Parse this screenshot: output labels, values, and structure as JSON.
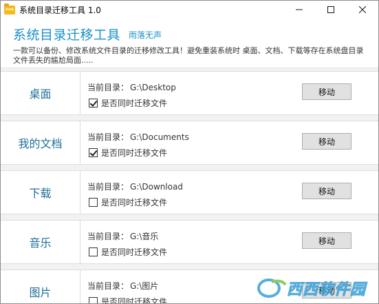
{
  "window": {
    "title": "系统目录迁移工具 1.0",
    "controls": {
      "minimize": "minimize",
      "maximize": "maximize",
      "close": "close"
    }
  },
  "header": {
    "title": "系统目录迁移工具",
    "author": "雨落无声",
    "description": "一款可以备份、修改系统文件目录的迁移修改工具！避免重装系统时 桌面、文档、下载等存在系统盘目录文件丢失的尴尬局面....."
  },
  "current_dir_prefix": "当前目录：",
  "checkbox_label": "是否同时迁移文件",
  "move_label": "移动",
  "rows": [
    {
      "label": "桌面",
      "path": "G:\\Desktop",
      "checked": true
    },
    {
      "label": "我的文档",
      "path": "G:\\Documents",
      "checked": true
    },
    {
      "label": "下载",
      "path": "G:\\Download",
      "checked": false
    },
    {
      "label": "音乐",
      "path": "G:\\音乐",
      "checked": false
    },
    {
      "label": "图片",
      "path": "G:\\图片",
      "checked": false
    }
  ],
  "watermark": {
    "text": "西西软件园"
  },
  "colors": {
    "accent": "#1a8fc9",
    "row_label": "#1f6f99",
    "button_bg": "#e1e1e1"
  }
}
